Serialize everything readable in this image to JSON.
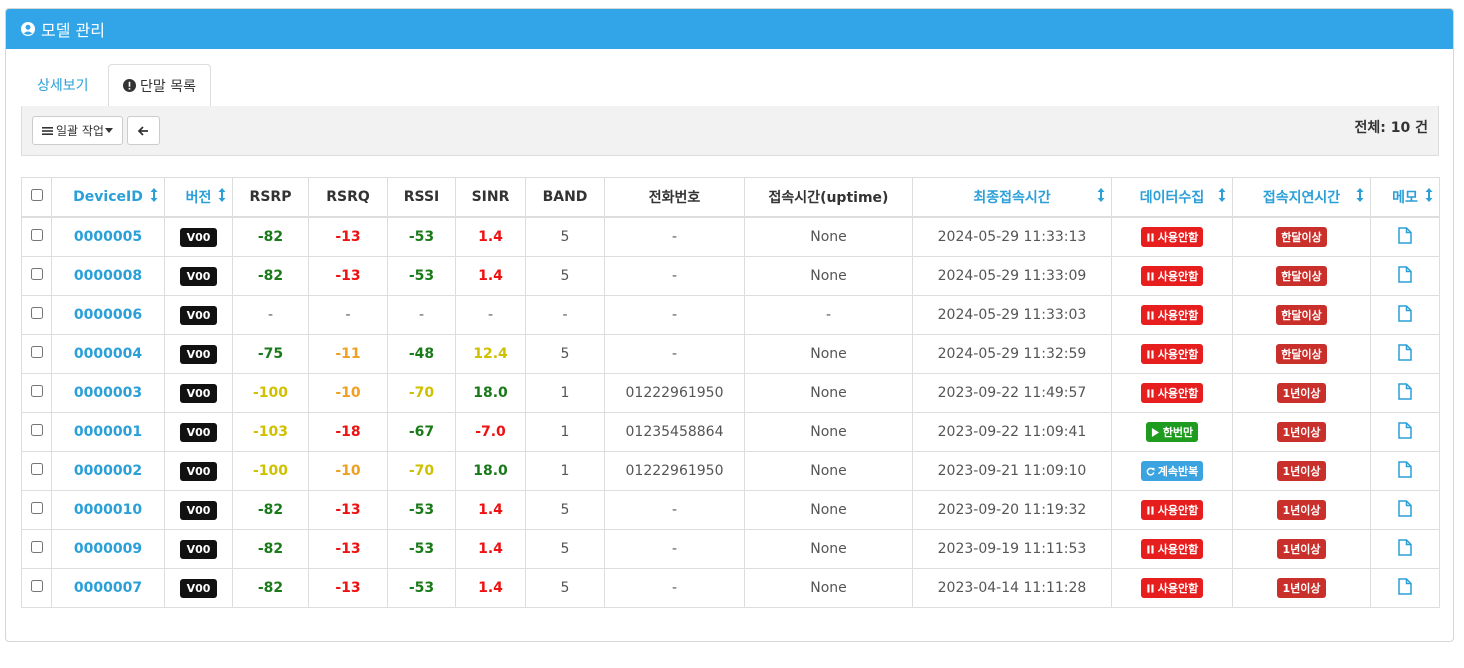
{
  "header": {
    "title": "모델 관리"
  },
  "tabs": [
    {
      "label": "상세보기"
    },
    {
      "label": "단말 목록"
    }
  ],
  "toolbar": {
    "bulk_label": "일괄 작업",
    "total_label": "전체: 10 건"
  },
  "columns": [
    "DeviceID",
    "버전",
    "RSRP",
    "RSRQ",
    "RSSI",
    "SINR",
    "BAND",
    "전화번호",
    "접속시간(uptime)",
    "최종접속시간",
    "데이터수집",
    "접속지연시간",
    "메모"
  ],
  "rows": [
    {
      "id": "0000005",
      "ver": "V00",
      "rsrp": "-82",
      "rsrq": "-13",
      "rssi": "-53",
      "sinr": "1.4",
      "band": "5",
      "phone": "-",
      "uptime": "None",
      "last": "2024-05-29 11:33:13",
      "collect": "사용안함",
      "delay": "한달이상"
    },
    {
      "id": "0000008",
      "ver": "V00",
      "rsrp": "-82",
      "rsrq": "-13",
      "rssi": "-53",
      "sinr": "1.4",
      "band": "5",
      "phone": "-",
      "uptime": "None",
      "last": "2024-05-29 11:33:09",
      "collect": "사용안함",
      "delay": "한달이상"
    },
    {
      "id": "0000006",
      "ver": "V00",
      "rsrp": "-",
      "rsrq": "-",
      "rssi": "-",
      "sinr": "-",
      "band": "-",
      "phone": "-",
      "uptime": "-",
      "last": "2024-05-29 11:33:03",
      "collect": "사용안함",
      "delay": "한달이상"
    },
    {
      "id": "0000004",
      "ver": "V00",
      "rsrp": "-75",
      "rsrq": "-11",
      "rssi": "-48",
      "sinr": "12.4",
      "band": "5",
      "phone": "-",
      "uptime": "None",
      "last": "2024-05-29 11:32:59",
      "collect": "사용안함",
      "delay": "한달이상"
    },
    {
      "id": "0000003",
      "ver": "V00",
      "rsrp": "-100",
      "rsrq": "-10",
      "rssi": "-70",
      "sinr": "18.0",
      "band": "1",
      "phone": "01222961950",
      "uptime": "None",
      "last": "2023-09-22 11:49:57",
      "collect": "사용안함",
      "delay": "1년이상"
    },
    {
      "id": "0000001",
      "ver": "V00",
      "rsrp": "-103",
      "rsrq": "-18",
      "rssi": "-67",
      "sinr": "-7.0",
      "band": "1",
      "phone": "01235458864",
      "uptime": "None",
      "last": "2023-09-22 11:09:41",
      "collect": "한번만",
      "delay": "1년이상"
    },
    {
      "id": "0000002",
      "ver": "V00",
      "rsrp": "-100",
      "rsrq": "-10",
      "rssi": "-70",
      "sinr": "18.0",
      "band": "1",
      "phone": "01222961950",
      "uptime": "None",
      "last": "2023-09-21 11:09:10",
      "collect": "계속반복",
      "delay": "1년이상"
    },
    {
      "id": "0000010",
      "ver": "V00",
      "rsrp": "-82",
      "rsrq": "-13",
      "rssi": "-53",
      "sinr": "1.4",
      "band": "5",
      "phone": "-",
      "uptime": "None",
      "last": "2023-09-20 11:19:32",
      "collect": "사용안함",
      "delay": "1년이상"
    },
    {
      "id": "0000009",
      "ver": "V00",
      "rsrp": "-82",
      "rsrq": "-13",
      "rssi": "-53",
      "sinr": "1.4",
      "band": "5",
      "phone": "-",
      "uptime": "None",
      "last": "2023-09-19 11:11:53",
      "collect": "사용안함",
      "delay": "1년이상"
    },
    {
      "id": "0000007",
      "ver": "V00",
      "rsrp": "-82",
      "rsrq": "-13",
      "rssi": "-53",
      "sinr": "1.4",
      "band": "5",
      "phone": "-",
      "uptime": "None",
      "last": "2023-04-14 11:11:28",
      "collect": "사용안함",
      "delay": "1년이상"
    }
  ],
  "colors": {
    "header_bg": "#31a5e8",
    "link": "#2a9fd8",
    "good": "#1a7a1a",
    "bad": "#ee1111",
    "warn_orange": "#f0a020",
    "warn_yellow": "#cfc000"
  }
}
